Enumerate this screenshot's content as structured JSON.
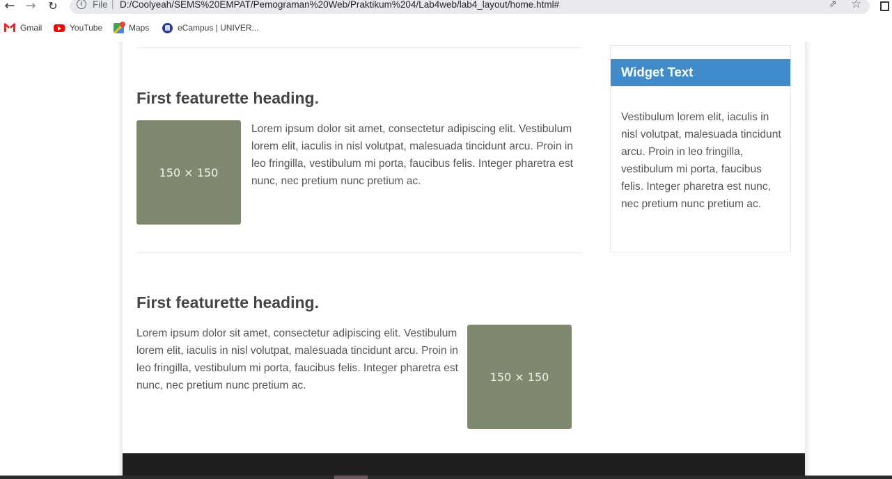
{
  "browser": {
    "address": {
      "scheme_label": "File",
      "url": "D:/Coolyeah/SEMS%20EMPAT/Pemograman%20Web/Praktikum%204/Lab4web/lab4_layout/home.html#"
    },
    "bookmarks": [
      {
        "label": "Gmail",
        "icon": "gmail-icon"
      },
      {
        "label": "YouTube",
        "icon": "youtube-icon"
      },
      {
        "label": "Maps",
        "icon": "maps-icon"
      },
      {
        "label": "eCampus | UNIVER...",
        "icon": "ecampus-icon"
      }
    ]
  },
  "page": {
    "featurettes": [
      {
        "heading": "First featurette heading.",
        "image_label": "150 × 150",
        "text": "Lorem ipsum dolor sit amet, consectetur adipiscing elit. Vestibulum lorem elit, iaculis in nisl volutpat, malesuada tincidunt arcu. Proin in leo fringilla, vestibulum mi porta, faucibus felis. Integer pharetra est nunc, nec pretium nunc pretium ac."
      },
      {
        "heading": "First featurette heading.",
        "image_label": "150 × 150",
        "text": "Lorem ipsum dolor sit amet, consectetur adipiscing elit. Vestibulum lorem elit, iaculis in nisl volutpat, malesuada tincidunt arcu. Proin in leo fringilla, vestibulum mi porta, faucibus felis. Integer pharetra est nunc, nec pretium nunc pretium ac."
      }
    ],
    "widget": {
      "title": "Widget Text",
      "body": "Vestibulum lorem elit, iaculis in nisl volutpat, malesuada tincidunt arcu. Proin in leo fringilla, vestibulum mi porta, faucibus felis. Integer pharetra est nunc, nec pretium nunc pretium ac."
    }
  },
  "colors": {
    "widget_header": "#428bca",
    "placeholder_image": "#7e8970",
    "footer": "#1f1f1f",
    "heading_text": "#444444",
    "body_text": "#555555"
  }
}
